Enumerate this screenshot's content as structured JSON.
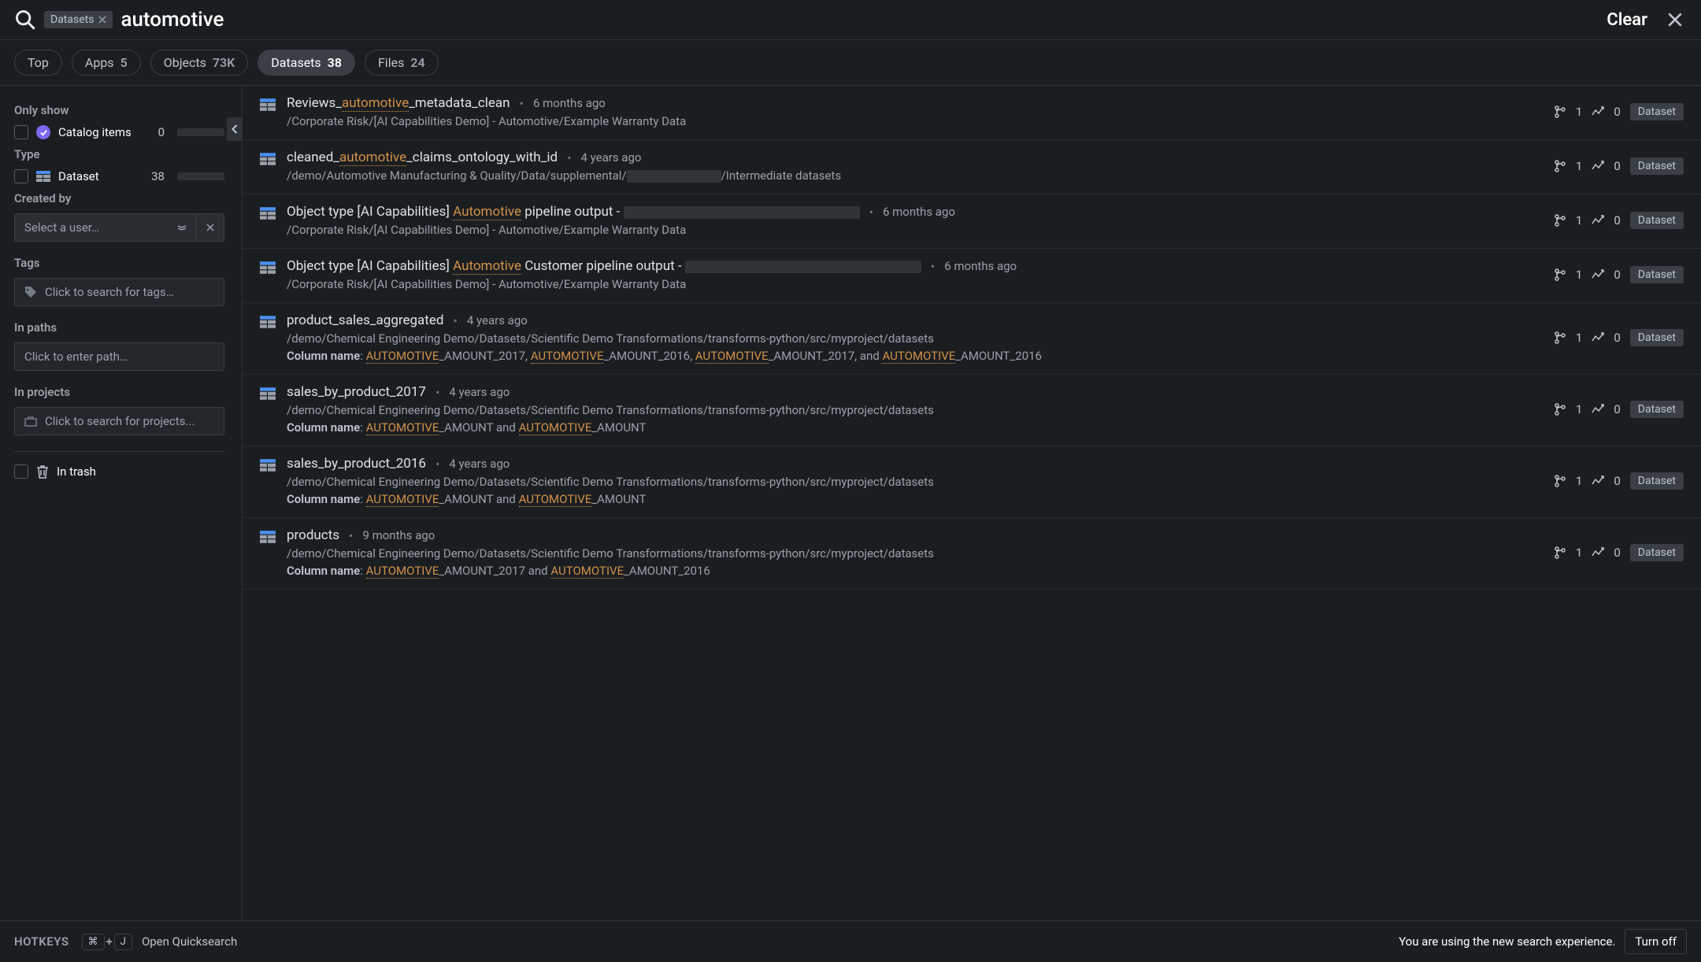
{
  "search": {
    "chip": "Datasets",
    "query": "automotive",
    "clear": "Clear"
  },
  "tabs": [
    {
      "label": "Top",
      "count": ""
    },
    {
      "label": "Apps",
      "count": "5"
    },
    {
      "label": "Objects",
      "count": "73K"
    },
    {
      "label": "Datasets",
      "count": "38",
      "active": true
    },
    {
      "label": "Files",
      "count": "24"
    }
  ],
  "sidebar": {
    "only_show": "Only show",
    "catalog": {
      "label": "Catalog items",
      "count": "0",
      "bar_pct": 0
    },
    "type_label": "Type",
    "dataset_filter": {
      "label": "Dataset",
      "count": "38",
      "bar_pct": 100
    },
    "created_by": "Created by",
    "user_select_placeholder": "Select a user…",
    "tags_label": "Tags",
    "tags_placeholder": "Click to search for tags…",
    "paths_label": "In paths",
    "paths_placeholder": "Click to enter path…",
    "projects_label": "In projects",
    "projects_placeholder": "Click to search for projects...",
    "trash_label": "In trash"
  },
  "results": [
    {
      "title_pre": "Reviews_",
      "title_hl": "automotive",
      "title_post": "_metadata_clean",
      "redact_title_w": 0,
      "time": "6 months ago",
      "path": "/Corporate Risk/[AI Capabilities Demo] - Automotive/Example Warranty Data",
      "redact_path_w": 0,
      "extra": null,
      "m1": "1",
      "m2": "0",
      "tag": "Dataset"
    },
    {
      "title_pre": "cleaned_",
      "title_hl": "automotive",
      "title_post": "_claims_ontology_with_id",
      "redact_title_w": 0,
      "time": "4 years ago",
      "path": "/demo/Automotive Manufacturing & Quality/Data/supplemental/",
      "redact_path_w": 120,
      "path_post": "/Intermediate datasets",
      "extra": null,
      "m1": "1",
      "m2": "0",
      "tag": "Dataset"
    },
    {
      "title_pre": "Object type [AI Capabilities] ",
      "title_hl": "Automotive",
      "title_post": " pipeline output - ",
      "redact_title_w": 300,
      "time": "6 months ago",
      "path": "/Corporate Risk/[AI Capabilities Demo] - Automotive/Example Warranty Data",
      "redact_path_w": 0,
      "extra": null,
      "m1": "1",
      "m2": "0",
      "tag": "Dataset"
    },
    {
      "title_pre": "Object type [AI Capabilities] ",
      "title_hl": "Automotive",
      "title_post": " Customer pipeline output - ",
      "redact_title_w": 300,
      "time": "6 months ago",
      "path": "/Corporate Risk/[AI Capabilities Demo] - Automotive/Example Warranty Data",
      "redact_path_w": 0,
      "extra": null,
      "m1": "1",
      "m2": "0",
      "tag": "Dataset"
    },
    {
      "title_pre": "product_sales_aggregated",
      "title_hl": "",
      "title_post": "",
      "redact_title_w": 0,
      "time": "4 years ago",
      "path": "/demo/Chemical Engineering Demo/Datasets/Scientific Demo Transformations/transforms-python/src/myproject/datasets",
      "redact_path_w": 0,
      "extra": {
        "label": "Column name: ",
        "segments": [
          {
            "hl": "AUTOMOTIVE",
            "txt": "_AMOUNT_2017, "
          },
          {
            "hl": "AUTOMOTIVE",
            "txt": "_AMOUNT_2016, "
          },
          {
            "hl": "AUTOMOTIVE",
            "txt": "_AMOUNT_2017, and "
          },
          {
            "hl": "AUTOMOTIVE",
            "txt": "_AMOUNT_2016"
          }
        ]
      },
      "m1": "1",
      "m2": "0",
      "tag": "Dataset"
    },
    {
      "title_pre": "sales_by_product_2017",
      "title_hl": "",
      "title_post": "",
      "redact_title_w": 0,
      "time": "4 years ago",
      "path": "/demo/Chemical Engineering Demo/Datasets/Scientific Demo Transformations/transforms-python/src/myproject/datasets",
      "redact_path_w": 0,
      "extra": {
        "label": "Column name: ",
        "segments": [
          {
            "hl": "AUTOMOTIVE",
            "txt": "_AMOUNT and "
          },
          {
            "hl": "AUTOMOTIVE",
            "txt": "_AMOUNT"
          }
        ]
      },
      "m1": "1",
      "m2": "0",
      "tag": "Dataset"
    },
    {
      "title_pre": "sales_by_product_2016",
      "title_hl": "",
      "title_post": "",
      "redact_title_w": 0,
      "time": "4 years ago",
      "path": "/demo/Chemical Engineering Demo/Datasets/Scientific Demo Transformations/transforms-python/src/myproject/datasets",
      "redact_path_w": 0,
      "extra": {
        "label": "Column name: ",
        "segments": [
          {
            "hl": "AUTOMOTIVE",
            "txt": "_AMOUNT and "
          },
          {
            "hl": "AUTOMOTIVE",
            "txt": "_AMOUNT"
          }
        ]
      },
      "m1": "1",
      "m2": "0",
      "tag": "Dataset"
    },
    {
      "title_pre": "products",
      "title_hl": "",
      "title_post": "",
      "redact_title_w": 0,
      "time": "9 months ago",
      "path": "/demo/Chemical Engineering Demo/Datasets/Scientific Demo Transformations/transforms-python/src/myproject/datasets",
      "redact_path_w": 0,
      "extra": {
        "label": "Column name: ",
        "segments": [
          {
            "hl": "AUTOMOTIVE",
            "txt": "_AMOUNT_2017 and "
          },
          {
            "hl": "AUTOMOTIVE",
            "txt": "_AMOUNT_2016"
          }
        ]
      },
      "m1": "1",
      "m2": "0",
      "tag": "Dataset"
    }
  ],
  "footer": {
    "hotkeys": "HOTKEYS",
    "key1": "⌘",
    "plus": "+",
    "key2": "J",
    "open": "Open Quicksearch",
    "msg": "You are using the new search experience.",
    "turnoff": "Turn off"
  }
}
